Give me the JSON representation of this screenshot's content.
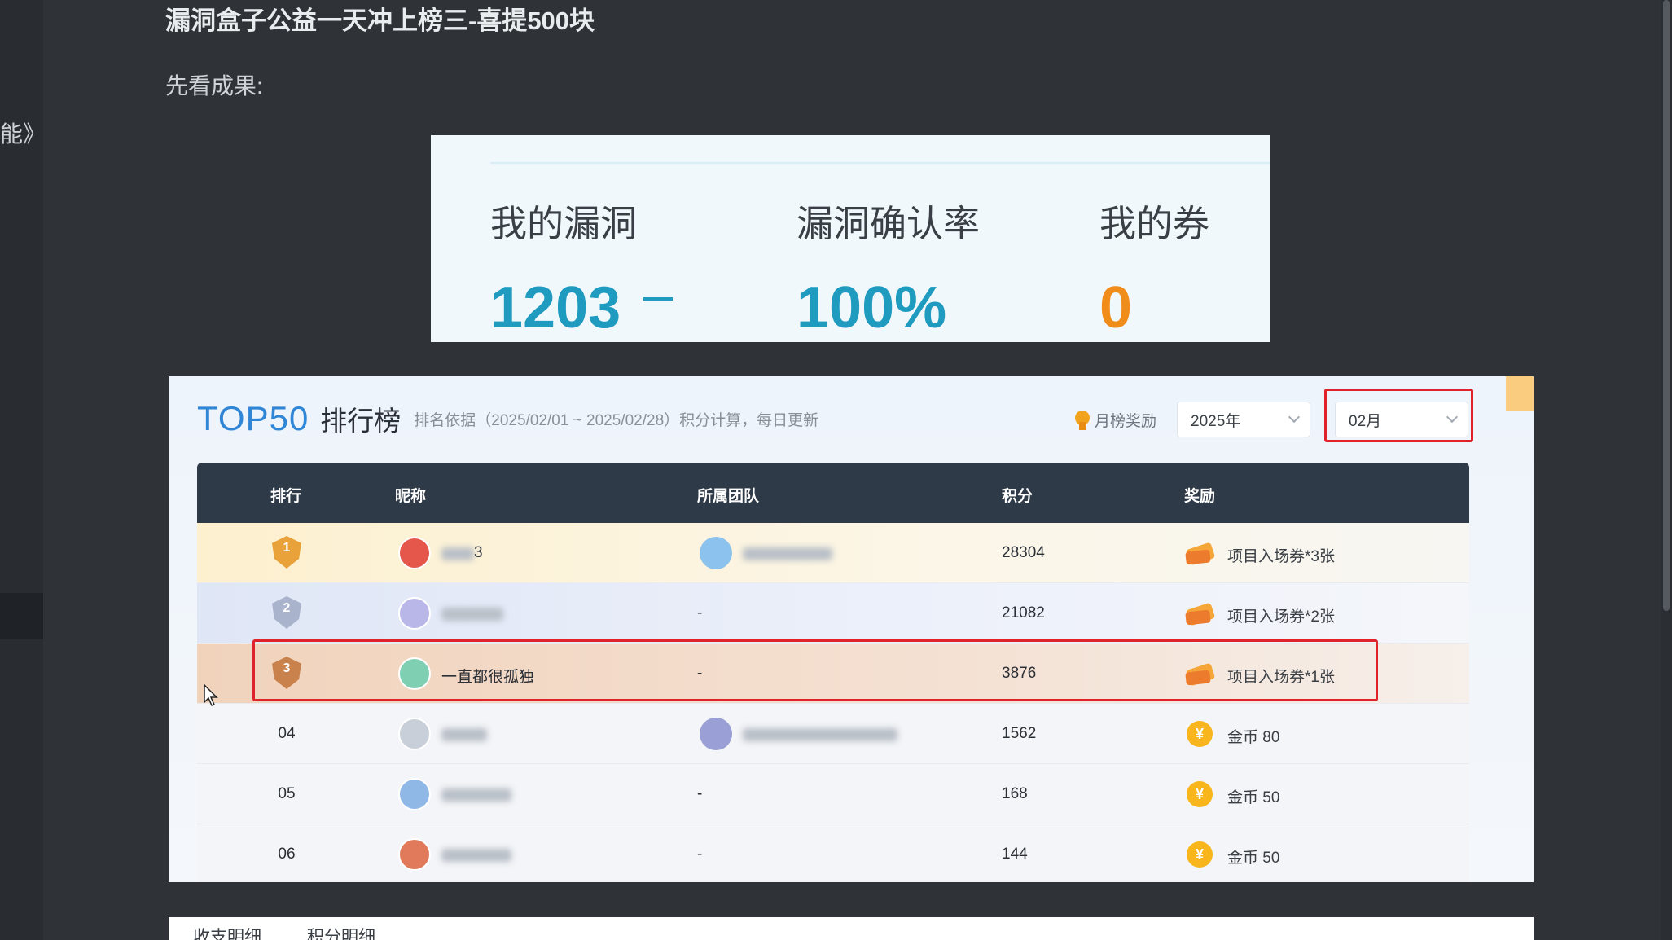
{
  "article": {
    "title": "漏洞盒子公益一天冲上榜三-喜提500块",
    "intro": "先看成果:",
    "left_fragment": "能》"
  },
  "stats": [
    {
      "label": "我的漏洞",
      "value": "1203",
      "color": "#1f9bbf"
    },
    {
      "label": "漏洞确认率",
      "value": "100%",
      "color": "#1f9bbf"
    },
    {
      "label": "我的券",
      "value": "0",
      "color": "#f08c1a"
    }
  ],
  "leaderboard": {
    "title_en": "TOP50",
    "title_cn": "排行榜",
    "basis": "排名依据（2025/02/01 ~ 2025/02/28）积分计算，每日更新",
    "monthly_reward": "月榜奖励",
    "year_select": "2025年",
    "month_select": "02月",
    "headers": {
      "rank": "排行",
      "nickname": "昵称",
      "team": "所属团队",
      "score": "积分",
      "reward": "奖励"
    },
    "rows": [
      {
        "rank": "1",
        "nickname": "3",
        "team": "",
        "score": "28304",
        "reward": "项目入场券*3张",
        "reward_type": "ticket"
      },
      {
        "rank": "2",
        "nickname": "",
        "team": "-",
        "score": "21082",
        "reward": "项目入场券*2张",
        "reward_type": "ticket"
      },
      {
        "rank": "3",
        "nickname": "一直都很孤独",
        "team": "-",
        "score": "3876",
        "reward": "项目入场券*1张",
        "reward_type": "ticket"
      },
      {
        "rank": "04",
        "nickname": "",
        "team": "",
        "score": "1562",
        "reward": "金币 80",
        "reward_type": "coin"
      },
      {
        "rank": "05",
        "nickname": "",
        "team": "-",
        "score": "168",
        "reward": "金币 50",
        "reward_type": "coin"
      },
      {
        "rank": "06",
        "nickname": "",
        "team": "-",
        "score": "144",
        "reward": "金币 50",
        "reward_type": "coin"
      }
    ]
  },
  "bottom_tabs": [
    "收支明细",
    "积分明细"
  ],
  "icons": {
    "coin_glyph": "¥"
  },
  "colors": {
    "highlight": "#e0222b",
    "accent_blue": "#2f86d6",
    "header_bg": "#2f3a48"
  }
}
